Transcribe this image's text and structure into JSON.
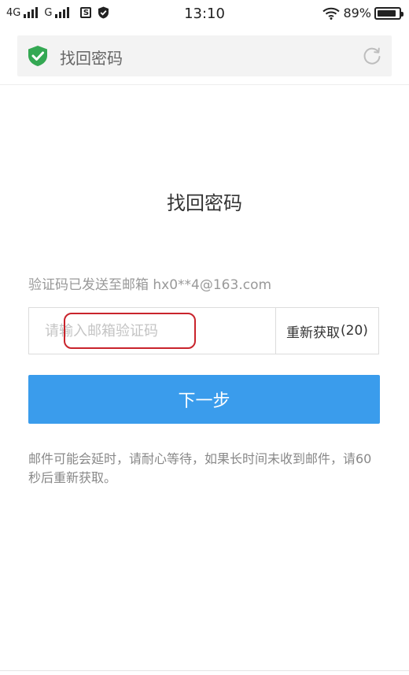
{
  "status_bar": {
    "network_1": "4G",
    "network_2": "G",
    "sim_label": "S",
    "time": "13:10",
    "battery_percent": "89%",
    "battery_level": 0.89,
    "icons": [
      "signal-bars-icon",
      "sim-icon",
      "shield-check-icon",
      "wifi-icon",
      "battery-icon"
    ]
  },
  "browser": {
    "page_title": "找回密码",
    "secure_icon": "shield-check-icon",
    "refresh_icon": "refresh-icon",
    "accent_color": "#34a853"
  },
  "main": {
    "title": "找回密码",
    "sent_message": "验证码已发送至邮箱 hx0**4@163.com",
    "code_input": {
      "placeholder": "请输入邮箱验证码",
      "value": ""
    },
    "resend": {
      "label": "重新获取",
      "countdown": "(20)"
    },
    "next_button": "下一步",
    "notice": "邮件可能会延时，请耐心等待，如果长时间未收到邮件，请60秒后重新获取。"
  },
  "colors": {
    "primary_button": "#3a9cec",
    "annotation_outline": "#c9242c"
  }
}
